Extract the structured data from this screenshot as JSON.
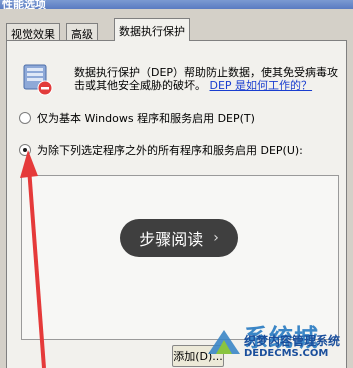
{
  "window": {
    "title": "性能选项"
  },
  "tabs": [
    {
      "label": "视觉效果"
    },
    {
      "label": "高级"
    },
    {
      "label": "数据执行保护"
    }
  ],
  "dep": {
    "description": "数据执行保护（DEP）帮助防止数据，使其免受病毒攻击或其他安全威胁的破坏。",
    "link": "DEP 是如何工作的？",
    "icon": "dep-shield-icon"
  },
  "options": [
    {
      "label": "仅为基本 Windows 程序和服务启用 DEP(T)",
      "checked": false
    },
    {
      "label": "为除下列选定程序之外的所有程序和服务启用 DEP(U):",
      "checked": true
    }
  ],
  "overlay": {
    "label": "步骤阅读"
  },
  "buttons": {
    "add": "添加(D)..."
  },
  "watermark": {
    "title": "系统城",
    "subtitle": "织梦内容管理系统",
    "url": "DEDECMS.COM"
  },
  "colors": {
    "arrow": "#e53a3a",
    "link": "#1a3ecf",
    "overlay": "#3f3f3f"
  }
}
